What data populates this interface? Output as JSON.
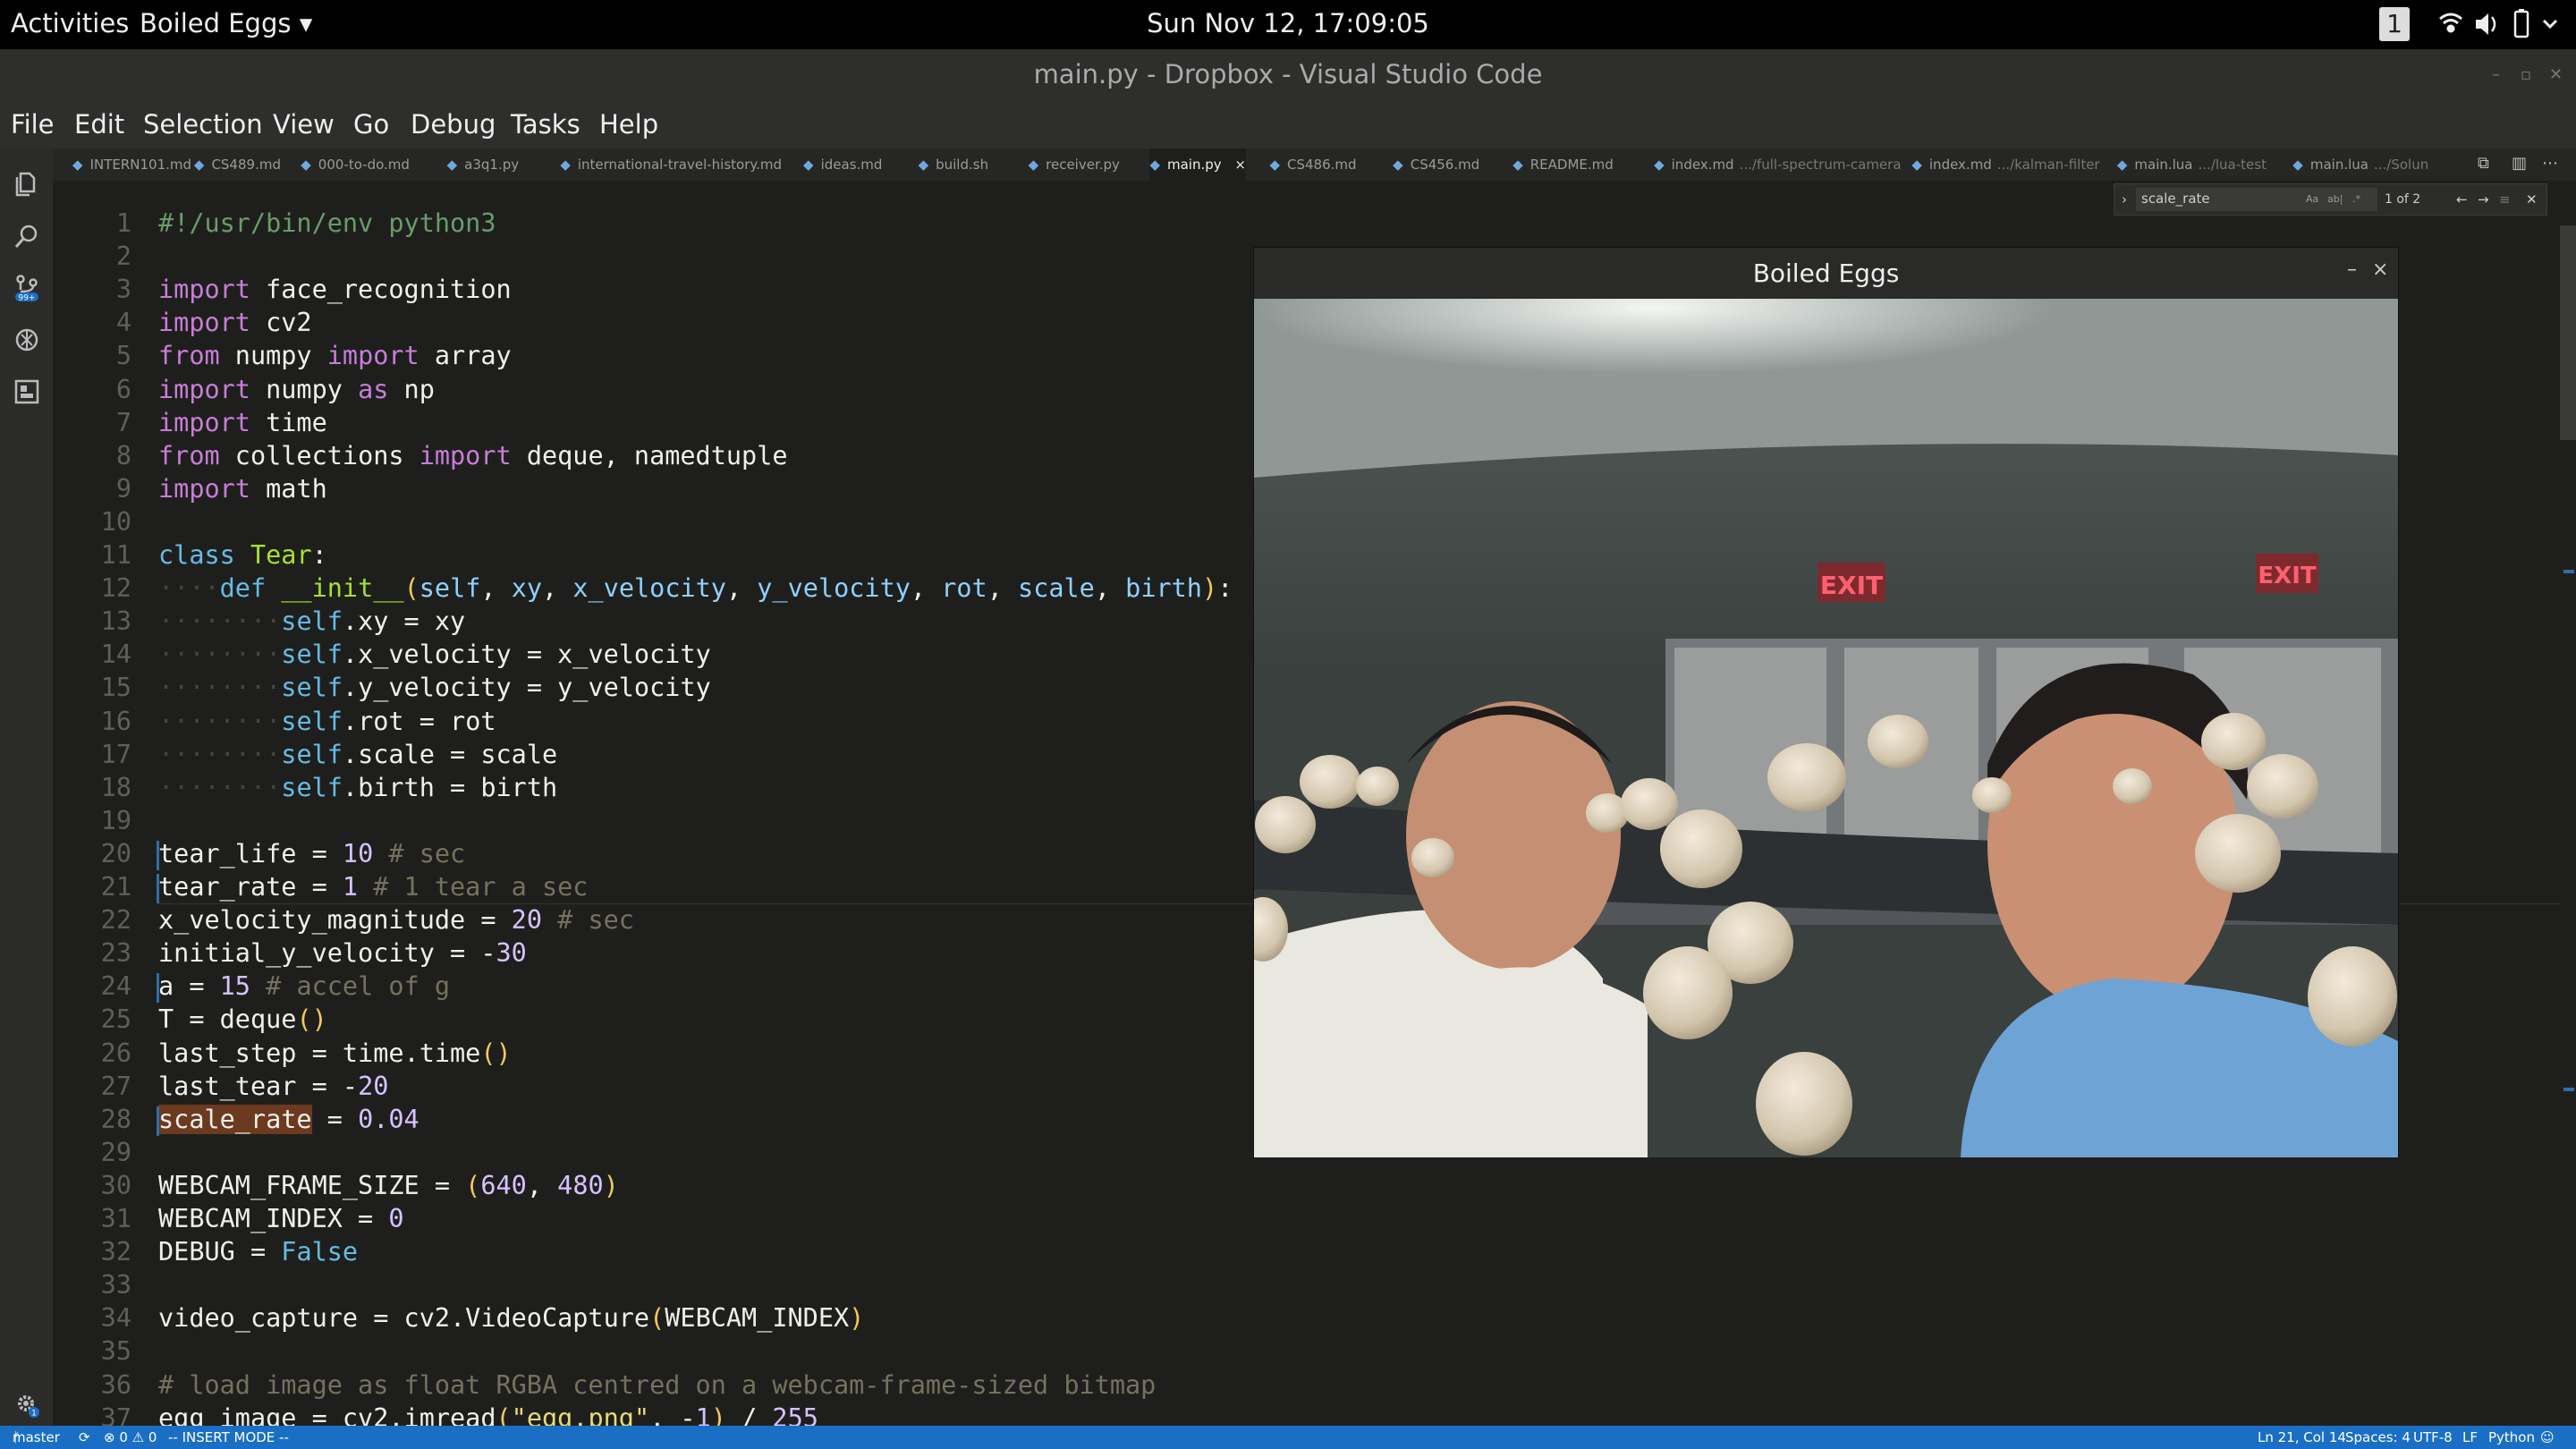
{
  "topbar": {
    "activities": "Activities",
    "app": "Boiled Eggs",
    "clock": "Sun Nov 12, 17:09:05",
    "workspace": "1"
  },
  "window": {
    "title": "main.py - Dropbox - Visual Studio Code"
  },
  "menu": [
    "File",
    "Edit",
    "Selection",
    "View",
    "Go",
    "Debug",
    "Tasks",
    "Help"
  ],
  "tabs": [
    {
      "label": "INTERN101.md",
      "dim": ""
    },
    {
      "label": "CS489.md",
      "dim": ""
    },
    {
      "label": "000-to-do.md",
      "dim": ""
    },
    {
      "label": "a3q1.py",
      "dim": ""
    },
    {
      "label": "international-travel-history.md",
      "dim": ""
    },
    {
      "label": "ideas.md",
      "dim": ""
    },
    {
      "label": "build.sh",
      "dim": ""
    },
    {
      "label": "receiver.py",
      "dim": ""
    },
    {
      "label": "main.py",
      "dim": ""
    },
    {
      "label": "CS486.md",
      "dim": ""
    },
    {
      "label": "CS456.md",
      "dim": ""
    },
    {
      "label": "README.md",
      "dim": ""
    },
    {
      "label": "index.md",
      "dim": ".../full-spectrum-camera"
    },
    {
      "label": "index.md",
      "dim": ".../kalman-filter"
    },
    {
      "label": "main.lua",
      "dim": ".../lua-test"
    },
    {
      "label": "main.lua",
      "dim": ".../Solun"
    }
  ],
  "active_tab_close": "×",
  "find": {
    "query": "scale_rate",
    "aa": "Aa",
    "ab": "ab|",
    "regex": ".*",
    "count": "1 of 2"
  },
  "popup": {
    "title": "Boiled Eggs",
    "min": "–",
    "close": "×"
  },
  "status": {
    "branch": "master",
    "sync": "⟳",
    "errors": "⊗ 0 ⚠ 0",
    "mode": "-- INSERT MODE --",
    "pos": "Ln 21, Col 14",
    "spaces": "Spaces: 4",
    "enc": "UTF-8",
    "eol": "LF",
    "lang": "Python"
  },
  "code": [
    {
      "n": "1",
      "t": [
        [
          "c2",
          "#!/usr/bin/env python3"
        ]
      ]
    },
    {
      "n": "2",
      "t": []
    },
    {
      "n": "3",
      "t": [
        [
          "k",
          "import"
        ],
        [
          "",
          "·face_recognition"
        ]
      ]
    },
    {
      "n": "4",
      "t": [
        [
          "k",
          "import"
        ],
        [
          "",
          "·cv2"
        ]
      ]
    },
    {
      "n": "5",
      "t": [
        [
          "k",
          "from"
        ],
        [
          "",
          "·numpy·"
        ],
        [
          "k",
          "import"
        ],
        [
          "",
          "·array"
        ]
      ]
    },
    {
      "n": "6",
      "t": [
        [
          "k",
          "import"
        ],
        [
          "",
          "·numpy·"
        ],
        [
          "k",
          "as"
        ],
        [
          "",
          "·np"
        ]
      ]
    },
    {
      "n": "7",
      "t": [
        [
          "k",
          "import"
        ],
        [
          "",
          "·time"
        ]
      ]
    },
    {
      "n": "8",
      "t": [
        [
          "k",
          "from"
        ],
        [
          "",
          "·collections·"
        ],
        [
          "k",
          "import"
        ],
        [
          "",
          "·deque,·namedtuple"
        ]
      ]
    },
    {
      "n": "9",
      "t": [
        [
          "k",
          "import"
        ],
        [
          "",
          "·math"
        ]
      ]
    },
    {
      "n": "10",
      "t": []
    },
    {
      "n": "11",
      "t": [
        [
          "kb",
          "class"
        ],
        [
          "",
          "·"
        ],
        [
          "fn",
          "Tear"
        ],
        [
          "",
          ":"
        ]
      ]
    },
    {
      "n": "12",
      "t": [
        [
          "g",
          "····"
        ],
        [
          "kb",
          "def"
        ],
        [
          "",
          "·"
        ],
        [
          "fn",
          "__init__"
        ],
        [
          "p",
          "("
        ],
        [
          "pa",
          "self"
        ],
        [
          "",
          ",·"
        ],
        [
          "pa",
          "xy"
        ],
        [
          "",
          ",·"
        ],
        [
          "pa",
          "x_velocity"
        ],
        [
          "",
          ",·"
        ],
        [
          "pa",
          "y_velocity"
        ],
        [
          "",
          ",·"
        ],
        [
          "pa",
          "rot"
        ],
        [
          "",
          ",·"
        ],
        [
          "pa",
          "scale"
        ],
        [
          "",
          ",·"
        ],
        [
          "pa",
          "birth"
        ],
        [
          "p",
          ")"
        ],
        [
          "",
          ":"
        ]
      ]
    },
    {
      "n": "13",
      "t": [
        [
          "g",
          "········"
        ],
        [
          "kb",
          "self"
        ],
        [
          "",
          ".xy·=·xy"
        ]
      ]
    },
    {
      "n": "14",
      "t": [
        [
          "g",
          "········"
        ],
        [
          "kb",
          "self"
        ],
        [
          "",
          ".x_velocity·=·x_velocity"
        ]
      ]
    },
    {
      "n": "15",
      "t": [
        [
          "g",
          "········"
        ],
        [
          "kb",
          "self"
        ],
        [
          "",
          ".y_velocity·=·y_velocity"
        ]
      ]
    },
    {
      "n": "16",
      "t": [
        [
          "g",
          "········"
        ],
        [
          "kb",
          "self"
        ],
        [
          "",
          ".rot·=·rot"
        ]
      ]
    },
    {
      "n": "17",
      "t": [
        [
          "g",
          "········"
        ],
        [
          "kb",
          "self"
        ],
        [
          "",
          ".scale·=·scale"
        ]
      ]
    },
    {
      "n": "18",
      "t": [
        [
          "g",
          "········"
        ],
        [
          "kb",
          "self"
        ],
        [
          "",
          ".birth·=·birth"
        ]
      ]
    },
    {
      "n": "19",
      "t": []
    },
    {
      "n": "20",
      "t": [
        [
          "",
          "tear_life·=·"
        ],
        [
          "n",
          "10"
        ],
        [
          "cm",
          "·#·sec"
        ]
      ]
    },
    {
      "n": "21",
      "t": [
        [
          "",
          "tear_rate·=·"
        ],
        [
          "n",
          "1"
        ],
        [
          "cm",
          "·#·1·tear·a·sec"
        ]
      ]
    },
    {
      "n": "22",
      "t": [
        [
          "",
          "x_velocity_magnitude·=·"
        ],
        [
          "n",
          "20"
        ],
        [
          "cm",
          "·#·sec"
        ]
      ]
    },
    {
      "n": "23",
      "t": [
        [
          "",
          "initial_y_velocity·=·-"
        ],
        [
          "n",
          "30"
        ]
      ]
    },
    {
      "n": "24",
      "t": [
        [
          "",
          "a·=·"
        ],
        [
          "n",
          "15"
        ],
        [
          "cm",
          "·#·accel·of·g"
        ]
      ]
    },
    {
      "n": "25",
      "t": [
        [
          "",
          "T·=·deque"
        ],
        [
          "p",
          "()"
        ]
      ]
    },
    {
      "n": "26",
      "t": [
        [
          "",
          "last_step·=·time.time"
        ],
        [
          "p",
          "()"
        ]
      ]
    },
    {
      "n": "27",
      "t": [
        [
          "",
          "last_tear·=·-"
        ],
        [
          "n",
          "20"
        ]
      ]
    },
    {
      "n": "28",
      "t": [
        [
          "hl",
          "scale_rate"
        ],
        [
          "",
          "·=·"
        ],
        [
          "n",
          "0.04"
        ]
      ]
    },
    {
      "n": "29",
      "t": []
    },
    {
      "n": "30",
      "t": [
        [
          "",
          "WEBCAM_FRAME_SIZE·=·"
        ],
        [
          "p",
          "("
        ],
        [
          "n",
          "640"
        ],
        [
          "",
          ",·"
        ],
        [
          "n",
          "480"
        ],
        [
          "p",
          ")"
        ]
      ]
    },
    {
      "n": "31",
      "t": [
        [
          "",
          "WEBCAM_INDEX·=·"
        ],
        [
          "n",
          "0"
        ]
      ]
    },
    {
      "n": "32",
      "t": [
        [
          "",
          "DEBUG·=·"
        ],
        [
          "kb",
          "False"
        ]
      ]
    },
    {
      "n": "33",
      "t": []
    },
    {
      "n": "34",
      "t": [
        [
          "",
          "video_capture·=·cv2.VideoCapture"
        ],
        [
          "p",
          "("
        ],
        [
          "",
          "WEBCAM_INDEX"
        ],
        [
          "p",
          ")"
        ]
      ]
    },
    {
      "n": "35",
      "t": []
    },
    {
      "n": "36",
      "t": [
        [
          "cm",
          "#·load·image·as·float·RGBA·centred·on·a·webcam-frame-sized·bitmap"
        ]
      ]
    },
    {
      "n": "37",
      "t": [
        [
          "",
          "egg_image·=·cv2.imread"
        ],
        [
          "p",
          "("
        ],
        [
          "s",
          "\"egg.png\""
        ],
        [
          "",
          ",·-"
        ],
        [
          "n",
          "1"
        ],
        [
          "p",
          ")"
        ],
        [
          "",
          "·/·"
        ],
        [
          "n",
          "255"
        ]
      ]
    }
  ],
  "colors": {
    "accent": "#1a6fc4",
    "editor_bg": "#1e1f1c",
    "highlight": "#6b3a1f"
  }
}
